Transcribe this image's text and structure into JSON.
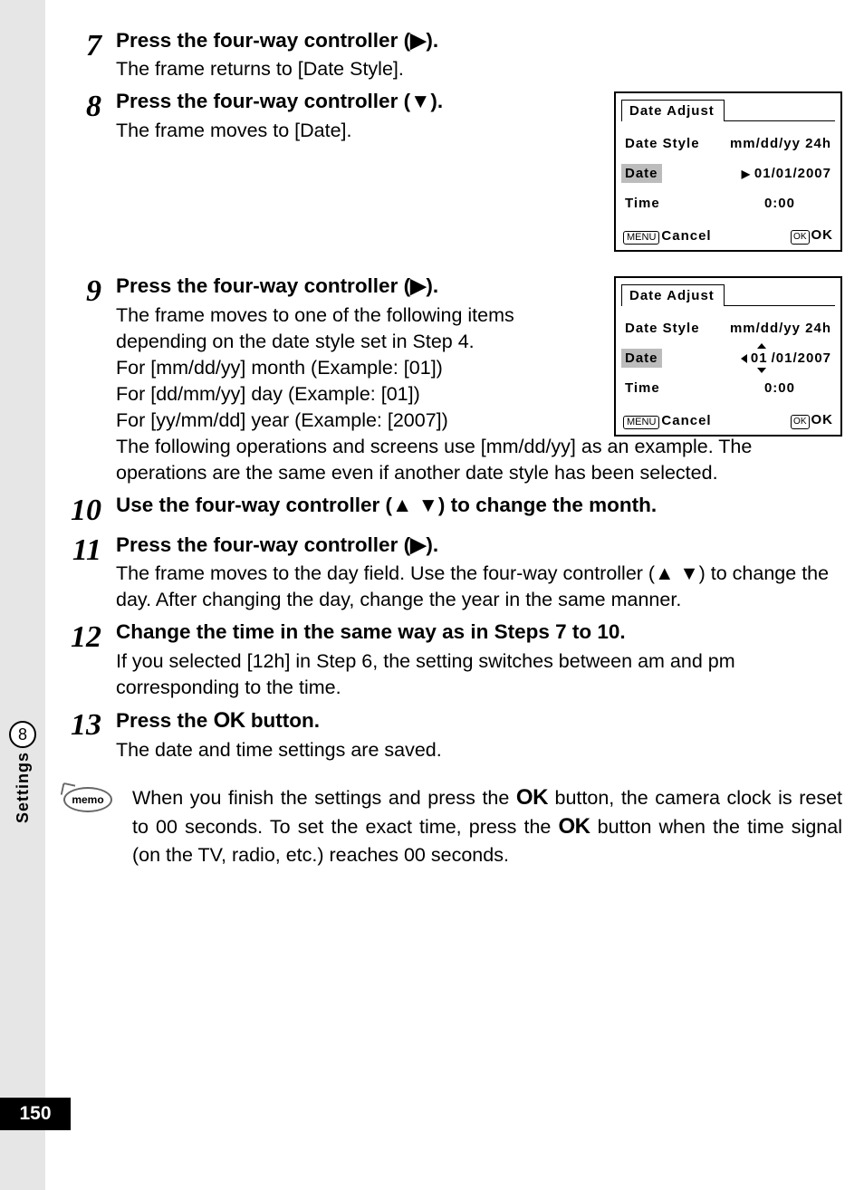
{
  "glyphs": {
    "right": "▶",
    "down": "▼",
    "up": "▲",
    "left": "◀"
  },
  "steps": {
    "s7": {
      "num": "7",
      "title_a": "Press the four-way controller (",
      "title_b": ").",
      "desc": "The frame returns to [Date Style]."
    },
    "s8": {
      "num": "8",
      "title_a": "Press the four-way controller (",
      "title_b": ").",
      "desc": "The frame moves to [Date]."
    },
    "s9": {
      "num": "9",
      "title_a": "Press the four-way controller (",
      "title_b": ").",
      "desc1": "The frame moves to one of the following items depending on the date style set in Step 4.",
      "desc2": "For [mm/dd/yy] month  (Example: [01])",
      "desc3": "For [dd/mm/yy] day  (Example: [01])",
      "desc4": "For [yy/mm/dd] year  (Example: [2007])",
      "desc5": "The following operations and screens use [mm/dd/yy] as an example. The operations are the same even if another date style has been selected."
    },
    "s10": {
      "num": "10",
      "title_a": "Use the four-way controller (",
      "title_b": ") to change the month."
    },
    "s11": {
      "num": "11",
      "title_a": "Press the four-way controller (",
      "title_b": ").",
      "desc_a": "The frame moves to the day field. Use the four-way controller (",
      "desc_b": ") to change the day. After changing the day, change the year in the same manner."
    },
    "s12": {
      "num": "12",
      "title": "Change the time in the same way as in Steps 7 to 10.",
      "desc": "If you selected [12h] in Step 6, the setting switches between am and pm corresponding to the time."
    },
    "s13": {
      "num": "13",
      "title_a": "Press the ",
      "title_ok": "OK",
      "title_b": " button.",
      "desc": "The date and time settings are saved."
    }
  },
  "lcd": {
    "title": "Date Adjust",
    "row_style_label": "Date Style",
    "row_style_val": "mm/dd/yy 24h",
    "row_date_label": "Date",
    "row_date_val": "01/01/2007",
    "row_time_label": "Time",
    "row_time_val": "0:00",
    "footer_menu": "MENU",
    "footer_cancel": "Cancel",
    "footer_ok_btn": "OK",
    "footer_ok": "OK"
  },
  "lcd2": {
    "date_first": "01",
    "date_rest": "/01/2007"
  },
  "memo": {
    "icon_label": "memo",
    "text_a": "When you finish the settings and press the ",
    "ok1": "OK",
    "text_b": " button, the camera clock is reset to 00 seconds. To set the exact time, press the ",
    "ok2": "OK",
    "text_c": " button when the time signal (on the TV, radio, etc.) reaches 00 seconds."
  },
  "side": {
    "chapter": "8",
    "label": "Settings"
  },
  "page_number": "150"
}
